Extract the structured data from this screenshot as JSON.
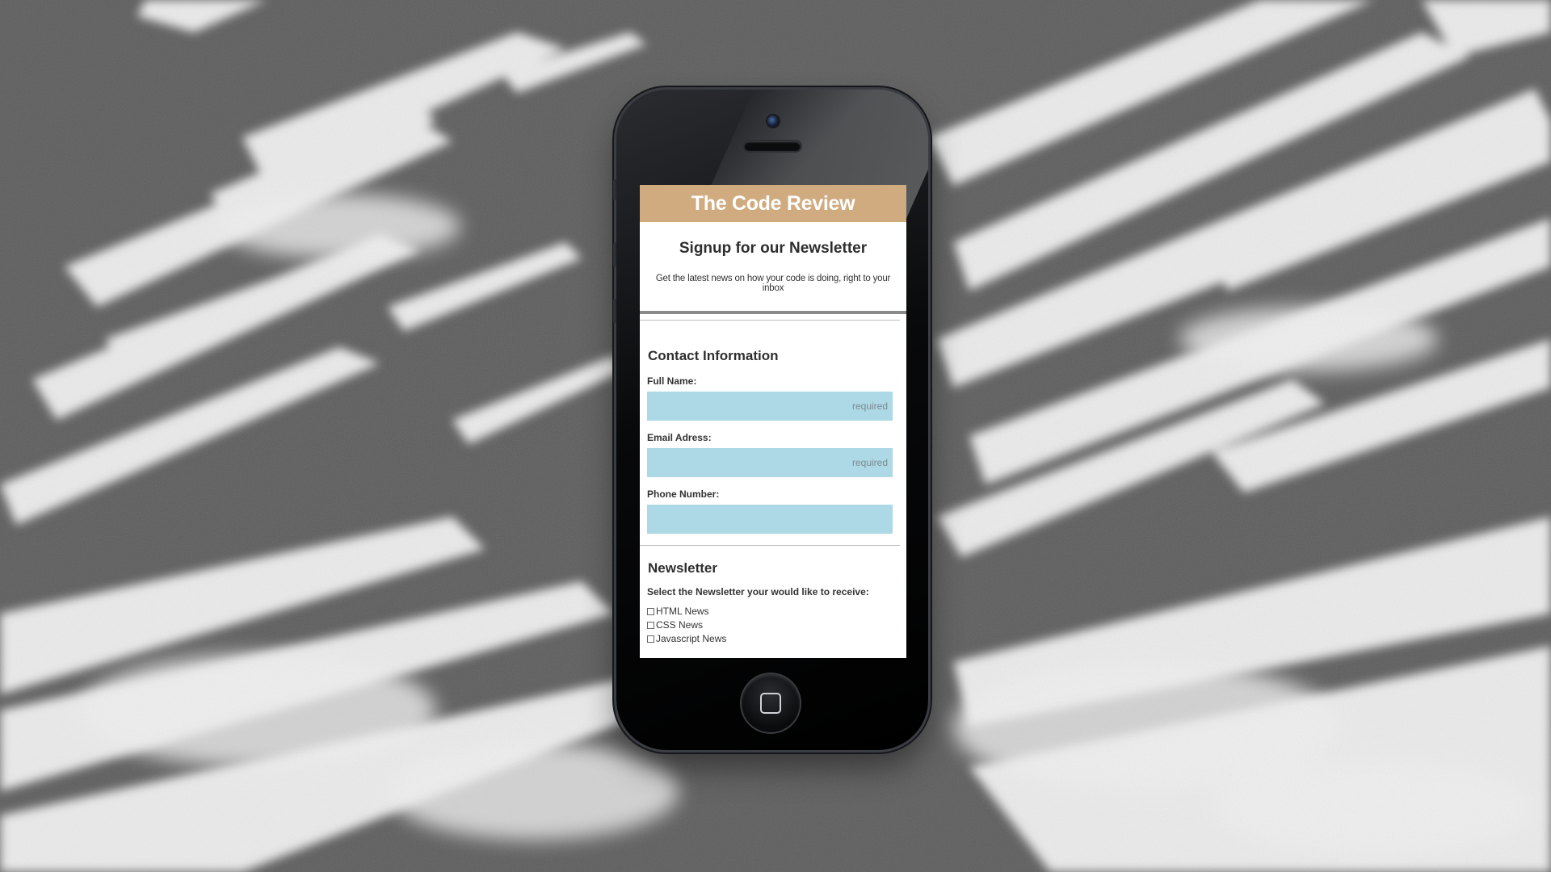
{
  "site": {
    "title": "The Code Review"
  },
  "intro": {
    "heading": "Signup for our Newsletter",
    "subtext": "Get the latest news on how your code is doing, right to your inbox"
  },
  "contact": {
    "heading": "Contact Information",
    "fields": [
      {
        "label": "Full Name:",
        "placeholder": "required",
        "value": ""
      },
      {
        "label": "Email Adress:",
        "placeholder": "required",
        "value": ""
      },
      {
        "label": "Phone Number:",
        "placeholder": "",
        "value": ""
      }
    ]
  },
  "newsletter": {
    "heading": "Newsletter",
    "prompt": "Select the Newsletter your would like to receive:",
    "options": [
      {
        "label": "HTML News",
        "checked": false
      },
      {
        "label": "CSS News",
        "checked": false
      },
      {
        "label": "Javascript News",
        "checked": false
      }
    ]
  },
  "colors": {
    "header_bg": "#cfab7f",
    "input_bg": "#add8e6",
    "phone_body": "#000000",
    "backdrop": "#5a5a5a"
  },
  "icons": {
    "camera": "front-camera-icon",
    "speaker": "earpiece-speaker-icon",
    "home": "home-button-square-icon"
  }
}
